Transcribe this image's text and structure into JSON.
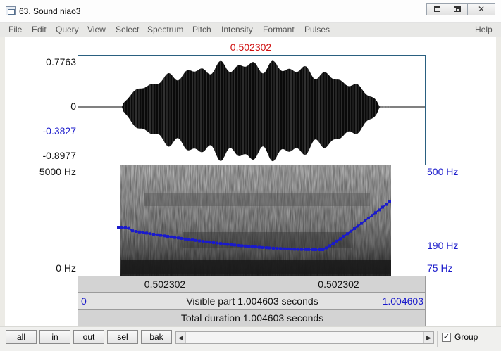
{
  "window": {
    "title": "63. Sound niao3",
    "controls": {
      "minimize": "minimize-icon",
      "maximize": "maximize-icon",
      "close": "✕"
    }
  },
  "menu": [
    "File",
    "Edit",
    "Query",
    "View",
    "Select",
    "Spectrum",
    "Pitch",
    "Intensity",
    "Formant",
    "Pulses",
    "Help"
  ],
  "cursor": {
    "time": "0.502302",
    "color": "#d01010"
  },
  "waveform": {
    "y_max": "0.7763",
    "y_zero": "0",
    "y_sel_upper": "-0.3827",
    "y_min": "-0.8977"
  },
  "spectrogram": {
    "freq_top": "5000 Hz",
    "freq_bottom": "0 Hz",
    "pitch_top": "500 Hz",
    "pitch_mark": "190 Hz",
    "pitch_bottom": "75 Hz",
    "pitch_color": "#1a1acb"
  },
  "rows": {
    "cursor_left": "0.502302",
    "cursor_right": "0.502302",
    "visible_start": "0",
    "visible_label": "Visible part 1.004603 seconds",
    "visible_end": "1.004603",
    "total_label": "Total duration 1.004603 seconds"
  },
  "bottom": {
    "buttons": [
      "all",
      "in",
      "out",
      "sel",
      "bak"
    ],
    "group_label": "Group",
    "group_checked": "✓"
  }
}
